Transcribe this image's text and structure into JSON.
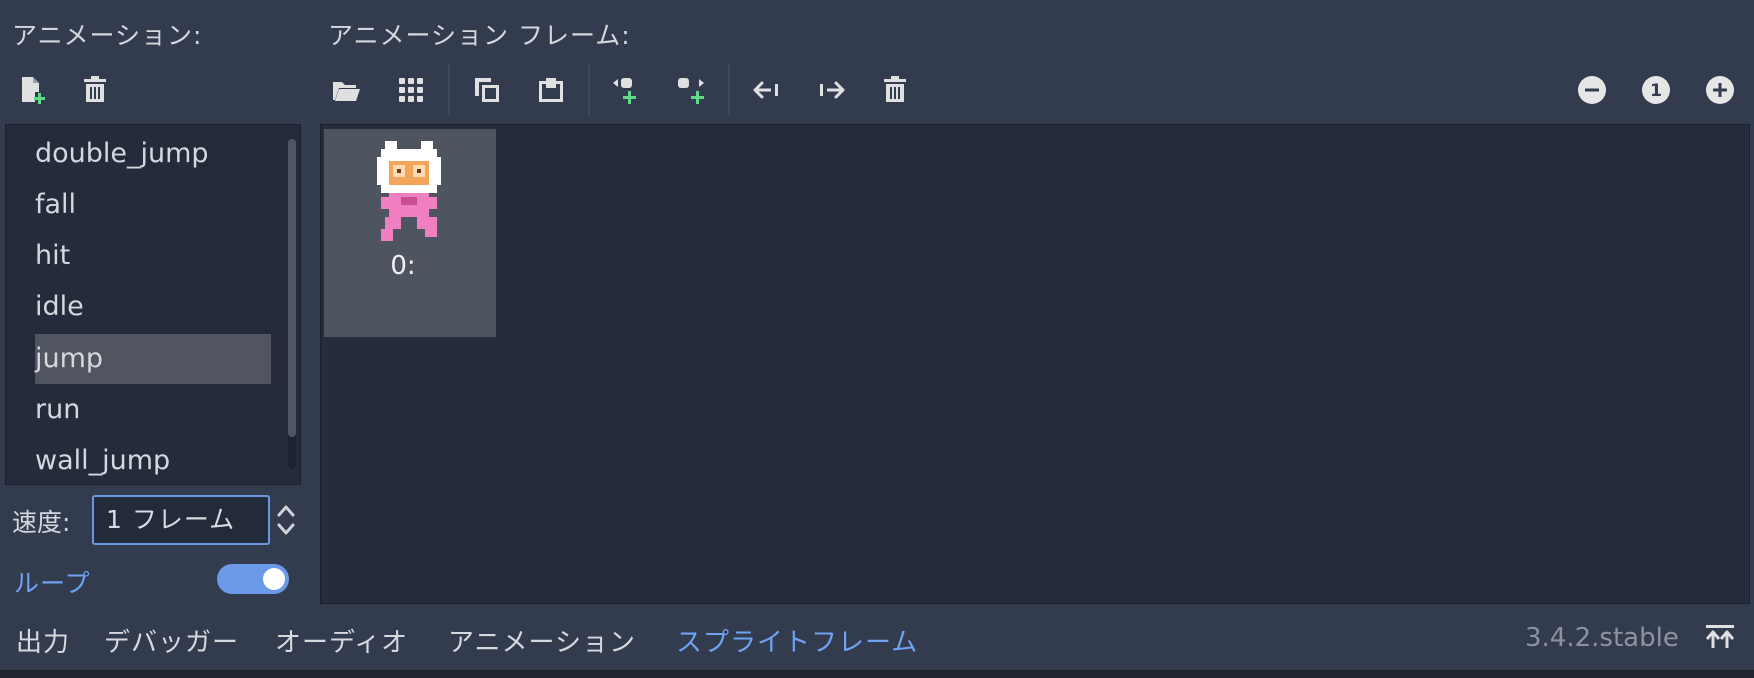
{
  "headers": {
    "animations": "アニメーション:",
    "frames": "アニメーション フレーム:"
  },
  "anim_toolbar": [
    {
      "icon": "new-animation-icon"
    },
    {
      "icon": "trash-icon"
    }
  ],
  "frames_toolbar": [
    {
      "icon": "folder-open-icon"
    },
    {
      "icon": "grid-icon"
    },
    {
      "icon": "copy-icon"
    },
    {
      "icon": "paste-icon"
    },
    {
      "icon": "insert-before-icon"
    },
    {
      "icon": "insert-after-icon"
    },
    {
      "icon": "move-left-icon"
    },
    {
      "icon": "move-right-icon"
    },
    {
      "icon": "trash-icon"
    }
  ],
  "zoom": [
    {
      "icon": "zoom-out-icon"
    },
    {
      "icon": "zoom-reset-icon",
      "label": "1"
    },
    {
      "icon": "zoom-in-icon"
    }
  ],
  "animations": [
    "double_jump",
    "fall",
    "hit",
    "idle",
    "jump",
    "run",
    "wall_jump"
  ],
  "selected_animation": "jump",
  "frames": [
    {
      "label": "0:"
    }
  ],
  "speed": {
    "label": "速度:",
    "value": "1 フレーム"
  },
  "loop": {
    "label": "ループ",
    "enabled": true
  },
  "bottom_tabs": [
    {
      "label": "出力",
      "active": false
    },
    {
      "label": "デバッガー",
      "active": false
    },
    {
      "label": "オーディオ",
      "active": false
    },
    {
      "label": "アニメーション",
      "active": false
    },
    {
      "label": "スプライトフレーム",
      "active": true
    }
  ],
  "version": "3.4.2.stable",
  "colors": {
    "background": "#333b4f",
    "panel": "#262c3b",
    "accent": "#6fa3f2",
    "selection": "#50555f",
    "add_green": "#5fd98a"
  }
}
